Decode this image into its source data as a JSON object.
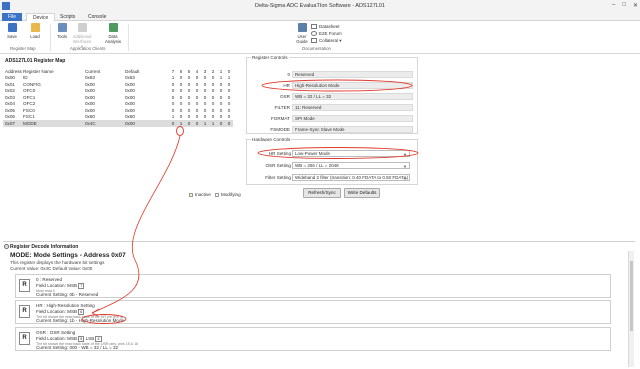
{
  "window": {
    "title": "Delta-Sigma ADC EvaluaTIon Software - ADS127L01",
    "controls": [
      "–",
      "□",
      "✕"
    ]
  },
  "ribbon_tabs": [
    "File",
    "Device",
    "Scripts",
    "Console"
  ],
  "ribbon": {
    "save": "Save",
    "load": "Load",
    "tools": "Tools",
    "additional_interfaces": "Additional Interfaces ▾",
    "data_analysis": "Data Analysis",
    "user_guide": "User Guide",
    "group_register_map": "Register Map",
    "group_application_clients": "Application Clients",
    "group_documentation": "Documentation",
    "datasheet": "Datasheet",
    "e2e_forum": "E2E Forum",
    "collateral": "Collateral ▾"
  },
  "register_map": {
    "title": "ADS127L01 Register Map",
    "headers": [
      "Address",
      "Register Name",
      "Current",
      "Default",
      "7",
      "6",
      "5",
      "4",
      "3",
      "2",
      "1",
      "0"
    ],
    "rows": [
      [
        "0x00",
        "ID",
        "0x83",
        "0x83",
        "1",
        "0",
        "0",
        "0",
        "0",
        "0",
        "1",
        "1"
      ],
      [
        "0x01",
        "CONFIG",
        "0x00",
        "0x00",
        "0",
        "0",
        "0",
        "0",
        "0",
        "0",
        "0",
        "0"
      ],
      [
        "0x02",
        "OFC0",
        "0x00",
        "0x00",
        "0",
        "0",
        "0",
        "0",
        "0",
        "0",
        "0",
        "0"
      ],
      [
        "0x03",
        "OFC1",
        "0x00",
        "0x00",
        "0",
        "0",
        "0",
        "0",
        "0",
        "0",
        "0",
        "0"
      ],
      [
        "0x04",
        "OFC2",
        "0x00",
        "0x00",
        "0",
        "0",
        "0",
        "0",
        "0",
        "0",
        "0",
        "0"
      ],
      [
        "0x05",
        "FSC0",
        "0x00",
        "0x00",
        "0",
        "0",
        "0",
        "0",
        "0",
        "0",
        "0",
        "0"
      ],
      [
        "0x06",
        "FSC1",
        "0x80",
        "0x80",
        "1",
        "0",
        "0",
        "0",
        "0",
        "0",
        "0",
        "0"
      ],
      [
        "0x07",
        "MODE",
        "0x4C",
        "0x00",
        "0",
        "1",
        "0",
        "0",
        "1",
        "1",
        "0",
        "0"
      ]
    ],
    "selected_row": 7
  },
  "register_controls": {
    "title": "Register Controls",
    "fields": [
      {
        "label": "0",
        "value": "Reserved"
      },
      {
        "label": "HR",
        "value": "High-Resolution Mode"
      },
      {
        "label": "OSR",
        "value": "WB = 32 / LL = 32"
      },
      {
        "label": "FILTER",
        "value": "11: Reserved"
      },
      {
        "label": "FORMAT",
        "value": "SPI Mode"
      },
      {
        "label": "FSMODE",
        "value": "Frame-Sync Slave Mode"
      }
    ]
  },
  "hardware_controls": {
    "title": "Hardware Controls",
    "fields": [
      {
        "label": "HR Setting",
        "value": "Low-Power Mode"
      },
      {
        "label": "OSR Setting",
        "value": "WB = 256 / LL = 2048"
      },
      {
        "label": "Filter Setting",
        "value": "Wideband 2 filter (transition: 0.40 FDATA to 0.50 FDATA)"
      }
    ]
  },
  "legend": {
    "inactive": "Inactive",
    "modifying": "Modifying"
  },
  "buttons": {
    "refresh": "Refresh/Sync",
    "write_defaults": "Write Defaults"
  },
  "decode": {
    "header": "Register Decode Information",
    "title": "MODE: Mode Settings - Address 0x07",
    "desc": "This register displays the hardware bit settings",
    "values": "Current Value: 0x4C   Default Value: 0x00",
    "cards": [
      {
        "badge": "R",
        "name": "0 :  Reserved",
        "location": "Field Location:  MSB",
        "bit": "7",
        "small": "Must read 0",
        "current": "Current Setting:  0b - Reserved"
      },
      {
        "badge": "R",
        "name": "HR :  High-Resolution Setting",
        "location": "Field Location:  MSB",
        "bit": "6",
        "small": "The bit shows the read back state of the HR pin (pin 4)",
        "current": "Current Setting:  1b - High-Resolution Mode"
      },
      {
        "badge": "R",
        "name": "OSR :  OSR Setting",
        "location": "Field Location:  MSB",
        "bit": "5",
        "lsb": "LSB",
        "lsb_bit": "4",
        "small": "The bit shows the read back state of the OSR pins, pins 15 & 16",
        "current": "Current Setting:  000 - WB = 32 / LL = 32"
      }
    ]
  },
  "colors": {
    "accent": "#3a73c4",
    "annotation": "#e0392b"
  }
}
